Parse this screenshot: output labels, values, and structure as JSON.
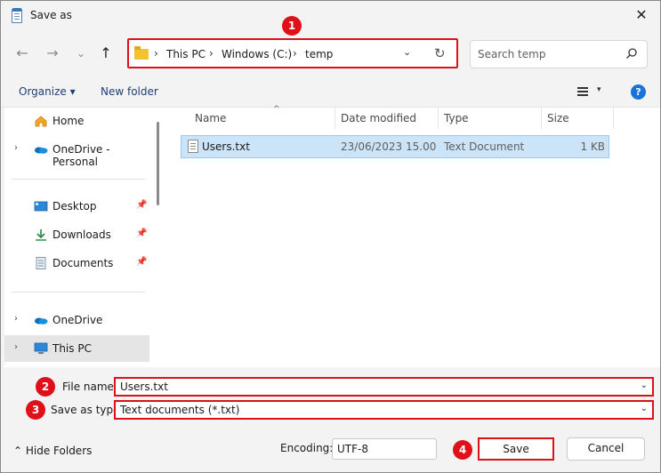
{
  "window": {
    "title": "Save as",
    "close": "✕"
  },
  "nav": {
    "back": "←",
    "forward": "→",
    "recent": "⌄",
    "up": "↑",
    "breadcrumbs": [
      "This PC",
      "Windows (C:)",
      "temp"
    ],
    "crumb_sep": "›",
    "dropdown": "⌄",
    "refresh": "↻",
    "search_placeholder": "Search temp"
  },
  "command_bar": {
    "organize": "Organize ▾",
    "new_folder": "New folder",
    "view_menu": "▾",
    "help": "?"
  },
  "sidebar": {
    "items": [
      {
        "label": "Home",
        "expander": "",
        "pinned": false,
        "icon": "home-icon"
      },
      {
        "label": "OneDrive - Personal",
        "expander": "›",
        "pinned": false,
        "icon": "onedrive-icon"
      },
      {
        "label": "Desktop",
        "expander": "",
        "pinned": true,
        "icon": "desktop-icon"
      },
      {
        "label": "Downloads",
        "expander": "",
        "pinned": true,
        "icon": "downloads-icon"
      },
      {
        "label": "Documents",
        "expander": "",
        "pinned": true,
        "icon": "documents-icon"
      },
      {
        "label": "OneDrive",
        "expander": "›",
        "pinned": false,
        "icon": "onedrive-icon"
      },
      {
        "label": "This PC",
        "expander": "›",
        "pinned": false,
        "icon": "computer-icon"
      }
    ],
    "pin": "📌"
  },
  "file_list": {
    "columns": [
      "Name",
      "Date modified",
      "Type",
      "Size"
    ],
    "sort_indicator": "^",
    "rows": [
      {
        "name": "Users.txt",
        "date_modified": "23/06/2023 15.00",
        "type": "Text Document",
        "size": "1 KB"
      }
    ]
  },
  "form": {
    "file_name_label": "File name:",
    "file_name_value": "Users.txt",
    "save_as_type_label": "Save as type:",
    "save_as_type_value": "Text documents (*.txt)",
    "combo_chevron": "⌄",
    "hide_folders": "⌃  Hide Folders",
    "encoding_label": "Encoding:",
    "encoding_value": "UTF-8",
    "save_label": "Save",
    "cancel_label": "Cancel"
  },
  "annotations": [
    "1",
    "2",
    "3",
    "4"
  ],
  "colors": {
    "highlight_red": "#e0101a",
    "selection": "#cce4f7",
    "accent_blue": "#1a73d9"
  }
}
